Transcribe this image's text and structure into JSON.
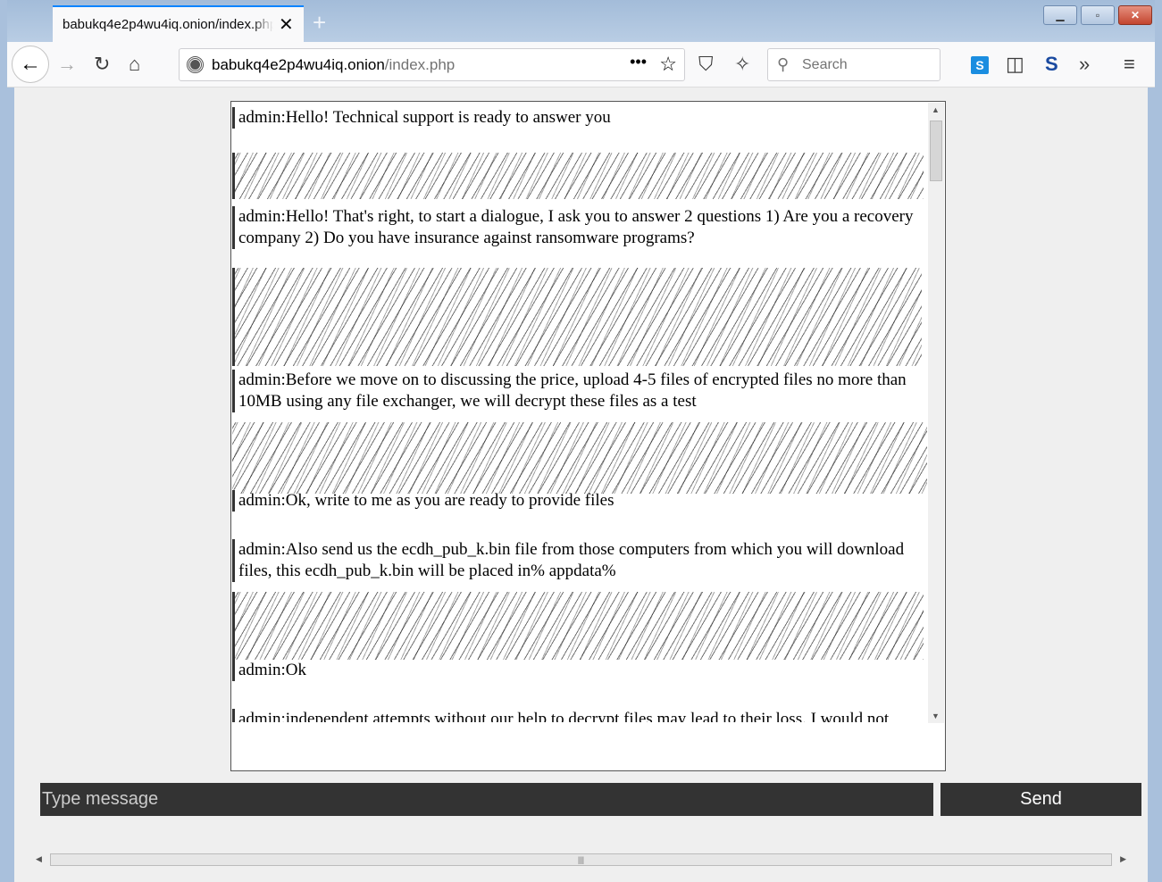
{
  "browser": {
    "tab_title": "babukq4e2p4wu4iq.onion/index.php",
    "url_host": "babukq4e2p4wu4iq.onion",
    "url_path": "/index.php",
    "search_placeholder": "Search"
  },
  "chat": {
    "messages": [
      "admin:Hello! Technical support is ready to answer you",
      "admin:Hello! That's right, to start a dialogue, I ask you to answer 2 questions 1) Are you a recovery company 2) Do you have insurance against ransomware programs?",
      "admin:Before we move on to discussing the price, upload 4-5 files of encrypted files no more than 10MB using any file exchanger, we will decrypt these files as a test",
      "admin:Ok, write to me as you are ready to provide files",
      "admin:Also send us the ecdh_pub_k.bin file from those computers from which you will download files, this ecdh_pub_k.bin will be placed in% appdata%",
      "admin:Ok",
      "admin:independent attempts without our help to decrypt files may lead to their loss. I would not"
    ],
    "input_placeholder": "Type message",
    "send_label": "Send"
  }
}
